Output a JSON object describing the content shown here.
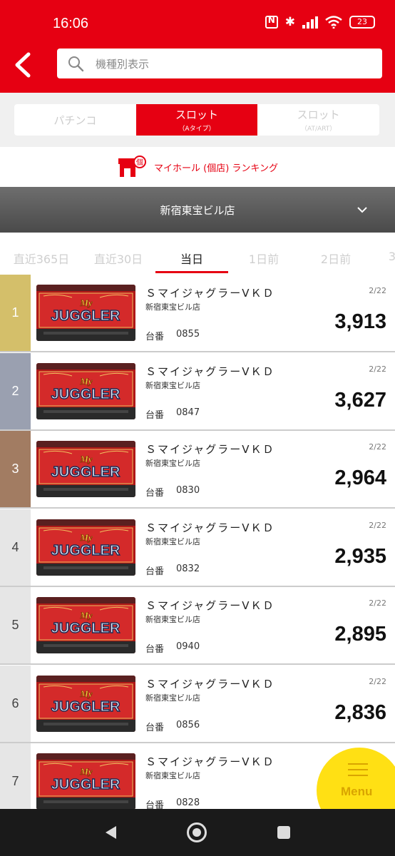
{
  "status": {
    "time": "16:06",
    "battery": "23"
  },
  "search": {
    "placeholder": "機種別表示"
  },
  "segments": [
    {
      "label": "パチンコ",
      "sub": ""
    },
    {
      "label": "スロット",
      "sub": "（Aタイプ）"
    },
    {
      "label": "スロット",
      "sub": "（AT/ART）"
    }
  ],
  "hall_ranking": {
    "label": "マイホール (個店) ランキング",
    "icon_char": "個"
  },
  "store": {
    "name": "新宿東宝ビル店"
  },
  "period_tabs": [
    "直近365日",
    "直近30日",
    "当日",
    "1日前",
    "2日前",
    "3"
  ],
  "unit_label": "台番",
  "rankings": [
    {
      "rank": "1",
      "name": "ＳマイジャグラーⅤＫＤ",
      "store": "新宿東宝ビル店",
      "unit": "0855",
      "date": "2/22",
      "value": "3,913",
      "rank_color": "#d4bf6a",
      "rank_text_color": "#ffffff"
    },
    {
      "rank": "2",
      "name": "ＳマイジャグラーⅤＫＤ",
      "store": "新宿東宝ビル店",
      "unit": "0847",
      "date": "2/22",
      "value": "3,627",
      "rank_color": "#9aa0b0",
      "rank_text_color": "#ffffff"
    },
    {
      "rank": "3",
      "name": "ＳマイジャグラーⅤＫＤ",
      "store": "新宿東宝ビル店",
      "unit": "0830",
      "date": "2/22",
      "value": "2,964",
      "rank_color": "#a27c62",
      "rank_text_color": "#ffffff"
    },
    {
      "rank": "4",
      "name": "ＳマイジャグラーⅤＫＤ",
      "store": "新宿東宝ビル店",
      "unit": "0832",
      "date": "2/22",
      "value": "2,935",
      "rank_color": "#e6e6e6",
      "rank_text_color": "#444444"
    },
    {
      "rank": "5",
      "name": "ＳマイジャグラーⅤＫＤ",
      "store": "新宿東宝ビル店",
      "unit": "0940",
      "date": "2/22",
      "value": "2,895",
      "rank_color": "#e6e6e6",
      "rank_text_color": "#444444"
    },
    {
      "rank": "6",
      "name": "ＳマイジャグラーⅤＫＤ",
      "store": "新宿東宝ビル店",
      "unit": "0856",
      "date": "2/22",
      "value": "2,836",
      "rank_color": "#e6e6e6",
      "rank_text_color": "#444444"
    },
    {
      "rank": "7",
      "name": "ＳマイジャグラーⅤＫＤ",
      "store": "新宿東宝ビル店",
      "unit": "0828",
      "date": "",
      "value": "",
      "rank_color": "#e6e6e6",
      "rank_text_color": "#444444"
    }
  ],
  "thumbnail": {
    "logo_top": "My",
    "logo_main": "JUGGLER"
  },
  "menu": {
    "label": "Menu"
  },
  "colors": {
    "brand_red": "#e60012",
    "menu_yellow": "#ffe014"
  }
}
